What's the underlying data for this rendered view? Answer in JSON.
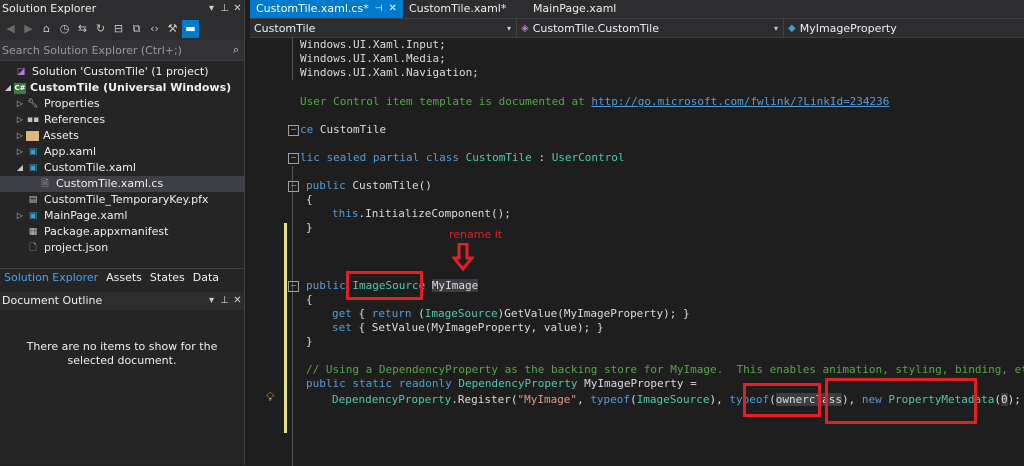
{
  "solution_explorer": {
    "title": "Solution Explorer",
    "search_placeholder": "Search Solution Explorer (Ctrl+;)",
    "tree": [
      {
        "label": "Solution 'CustomTile' (1 project)",
        "icon": "solution-icon"
      },
      {
        "label": "CustomTile (Universal Windows)",
        "icon": "project-icon"
      },
      {
        "label": "Properties",
        "icon": "wrench-icon"
      },
      {
        "label": "References",
        "icon": "references-icon"
      },
      {
        "label": "Assets",
        "icon": "folder-icon"
      },
      {
        "label": "App.xaml",
        "icon": "xaml-icon"
      },
      {
        "label": "CustomTile.xaml",
        "icon": "xaml-icon"
      },
      {
        "label": "CustomTile.xaml.cs",
        "icon": "cs-file-icon"
      },
      {
        "label": "CustomTile_TemporaryKey.pfx",
        "icon": "certificate-icon"
      },
      {
        "label": "MainPage.xaml",
        "icon": "xaml-icon"
      },
      {
        "label": "Package.appxmanifest",
        "icon": "manifest-icon"
      },
      {
        "label": "project.json",
        "icon": "json-icon"
      }
    ],
    "bottom_tabs": [
      "Solution Explorer",
      "Assets",
      "States",
      "Data"
    ]
  },
  "document_outline": {
    "title": "Document Outline",
    "empty_message": "There are no items to show for the selected document."
  },
  "editor": {
    "tabs": [
      {
        "label": "CustomTile.xaml.cs*",
        "active": true
      },
      {
        "label": "CustomTile.xaml*",
        "active": false
      },
      {
        "label": "MainPage.xaml",
        "active": false
      }
    ],
    "nav": {
      "project": "CustomTile",
      "class": "CustomTile.CustomTile",
      "member": "MyImageProperty"
    },
    "code": {
      "l1": "Windows.UI.Xaml.Input;",
      "l2": "Windows.UI.Xaml.Media;",
      "l3": "Windows.UI.Xaml.Navigation;",
      "comment_pre": "User Control item template is documented at ",
      "link": "http://go.microsoft.com/fwlink/?LinkId=234236",
      "ns_kw": "ce",
      "ns_name": "CustomTile",
      "class_decl_kw": "lic sealed partial class",
      "class_name": "CustomTile",
      "class_base": "UserControl",
      "ctor_kw": "public",
      "ctor_name": "CustomTile()",
      "brace_open": "{",
      "brace_close": "}",
      "init_this": "this",
      "init_call": ".InitializeComponent();",
      "prop_kw": "public",
      "prop_type": "ImageSource",
      "prop_name": "MyImage",
      "get_kw": "get",
      "get_rest_a": " { ",
      "return_kw": "return",
      "get_cast": "ImageSource",
      "get_rest_b": "GetValue(MyImageProperty); }",
      "set_kw": "set",
      "set_rest": " { SetValue(MyImageProperty, value); }",
      "dp_comment": "// Using a DependencyProperty as the backing store for MyImage.  This enables animation, styling, binding, etc...",
      "dp_kw": "public static readonly",
      "dp_type": "DependencyProperty",
      "dp_name": "MyImageProperty =",
      "reg_type": "DependencyProperty",
      "reg_call": ".Register(",
      "reg_str": "\"MyImage\"",
      "typeof_kw": "typeof",
      "reg_img": "ImageSource",
      "owner": "ownerclass",
      "new_kw": "new",
      "pm_type": "PropertyMetadata",
      "pm_arg": "0",
      "reg_end": ");"
    }
  },
  "annotation": {
    "rename_text": "rename it",
    "color": "#e01f26"
  }
}
